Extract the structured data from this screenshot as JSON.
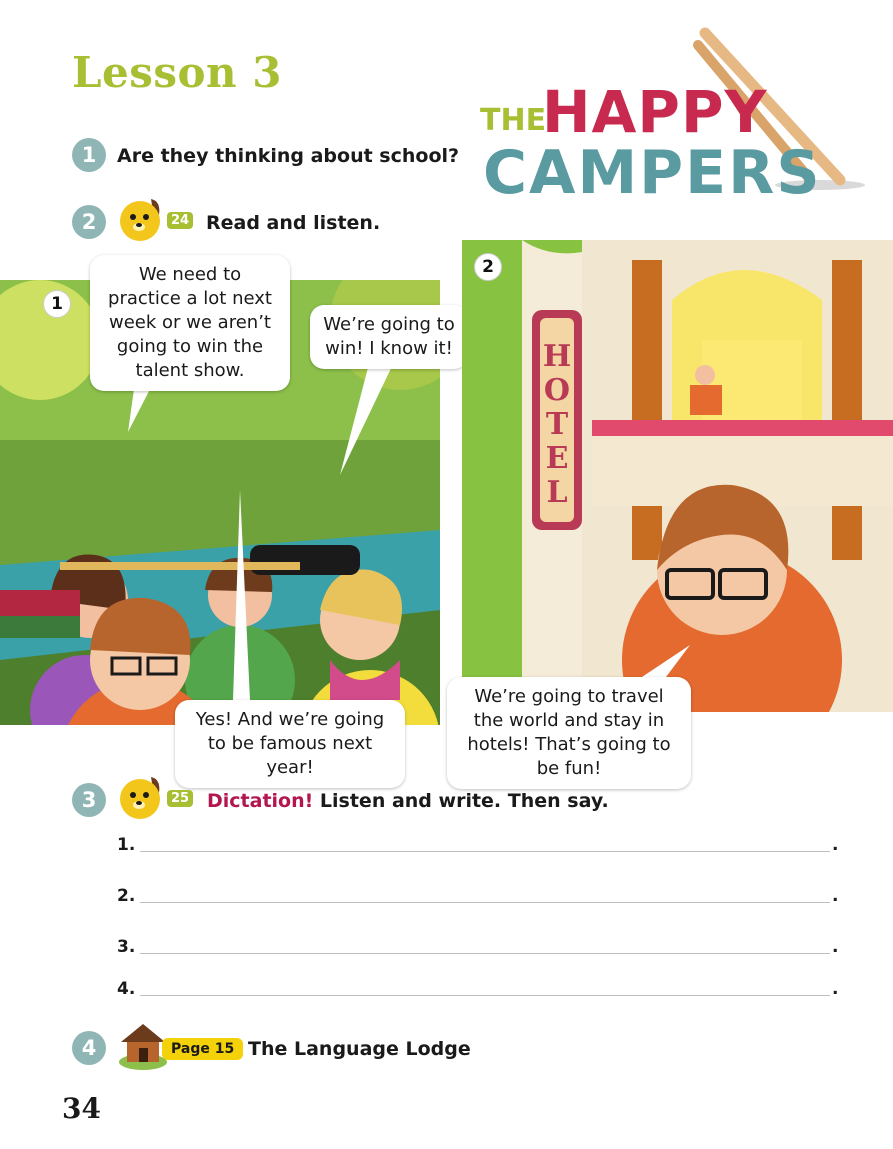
{
  "lesson_title": "Lesson 3",
  "logo": {
    "the": "THE",
    "happy": "HAPPY",
    "campers": "CAMPERS"
  },
  "activities": [
    {
      "number": "1",
      "text": "Are they thinking about school?"
    },
    {
      "number": "2",
      "track": "24",
      "text": "Read and listen."
    },
    {
      "number": "3",
      "track": "25",
      "highlight": "Dictation!",
      "text": "Listen and write. Then say."
    },
    {
      "number": "4",
      "page_badge": "Page 15",
      "text": "The Language Lodge"
    }
  ],
  "comic": {
    "panels": [
      {
        "number": "1",
        "speech": [
          "We need to practice a lot next week or we aren’t going to win the talent show.",
          "We’re going to win! I know it!",
          "Yes! And we’re going to be famous next year!"
        ]
      },
      {
        "number": "2",
        "sign": "HOTEL",
        "speech": [
          "We’re going to travel the world and stay in hotels! That’s going to be fun!"
        ]
      }
    ]
  },
  "dictation_lines": [
    {
      "label": "1.",
      "end": "."
    },
    {
      "label": "2.",
      "end": "."
    },
    {
      "label": "3.",
      "end": "."
    },
    {
      "label": "4.",
      "end": "."
    }
  ],
  "page_number": "34",
  "colors": {
    "accent_green": "#a8bf33",
    "circle_teal": "#8fb6b5",
    "dictation_red": "#b3154f",
    "badge_yellow": "#f4d20a"
  }
}
